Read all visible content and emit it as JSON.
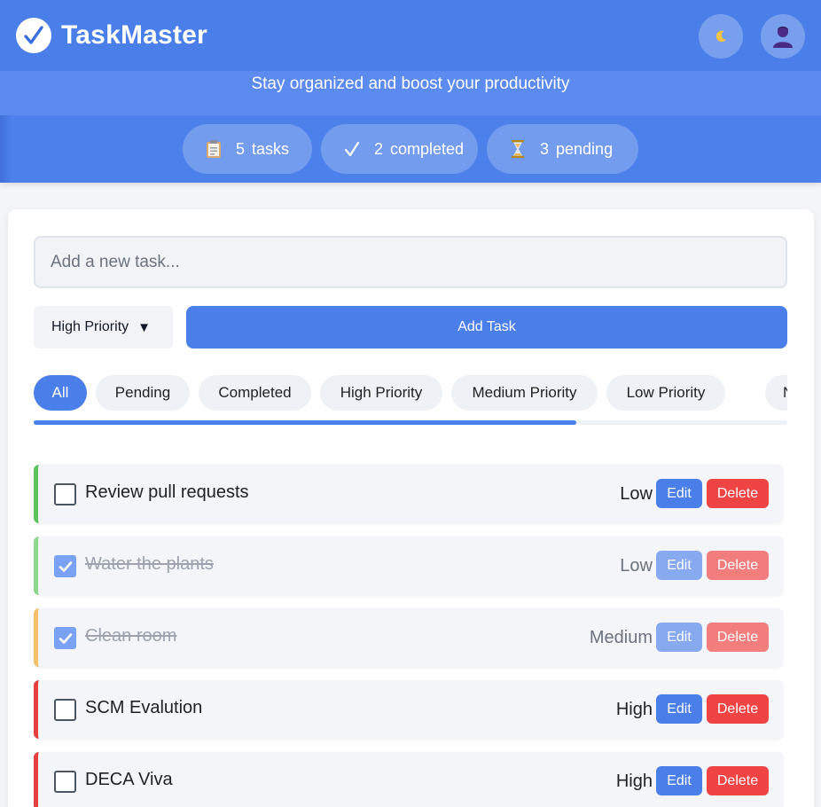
{
  "app": {
    "title": "TaskMaster",
    "subtitle": "Stay organized and boost your productivity",
    "theme_icon": "moon-icon",
    "user_icon": "user-avatar-icon"
  },
  "stats": {
    "tasks": {
      "count": "5",
      "label": "tasks",
      "icon": "clipboard-icon"
    },
    "completed": {
      "count": "2",
      "label": "completed",
      "icon": "checkmark-icon"
    },
    "pending": {
      "count": "3",
      "label": "pending",
      "icon": "hourglass-icon"
    }
  },
  "form": {
    "input_placeholder": "Add a new task...",
    "input_value": "",
    "priority_selected": "High Priority",
    "add_button": "Add Task"
  },
  "filters": [
    {
      "label": "All",
      "active": true
    },
    {
      "label": "Pending",
      "active": false
    },
    {
      "label": "Completed",
      "active": false
    },
    {
      "label": "High Priority",
      "active": false
    },
    {
      "label": "Medium Priority",
      "active": false
    },
    {
      "label": "Low Priority",
      "active": false
    },
    {
      "label": "N",
      "active": false
    }
  ],
  "filters_scroll_fraction": 0.72,
  "tasks": [
    {
      "text": "Review pull requests",
      "priority": "Low",
      "completed": false,
      "edit": "Edit",
      "delete": "Delete"
    },
    {
      "text": "Water the plants",
      "priority": "Low",
      "completed": true,
      "edit": "Edit",
      "delete": "Delete"
    },
    {
      "text": "Clean room",
      "priority": "Medium",
      "completed": true,
      "edit": "Edit",
      "delete": "Delete"
    },
    {
      "text": "SCM Evalution",
      "priority": "High",
      "completed": false,
      "edit": "Edit",
      "delete": "Delete"
    },
    {
      "text": "DECA Viva",
      "priority": "High",
      "completed": false,
      "edit": "Edit",
      "delete": "Delete"
    }
  ],
  "colors": {
    "primary": "#4a7fe9",
    "danger": "#ee4444",
    "priority_low": "#5cc25c",
    "priority_low_done": "#8fd68f",
    "priority_medium_done": "#f5c26b",
    "priority_high": "#e53e3e"
  }
}
